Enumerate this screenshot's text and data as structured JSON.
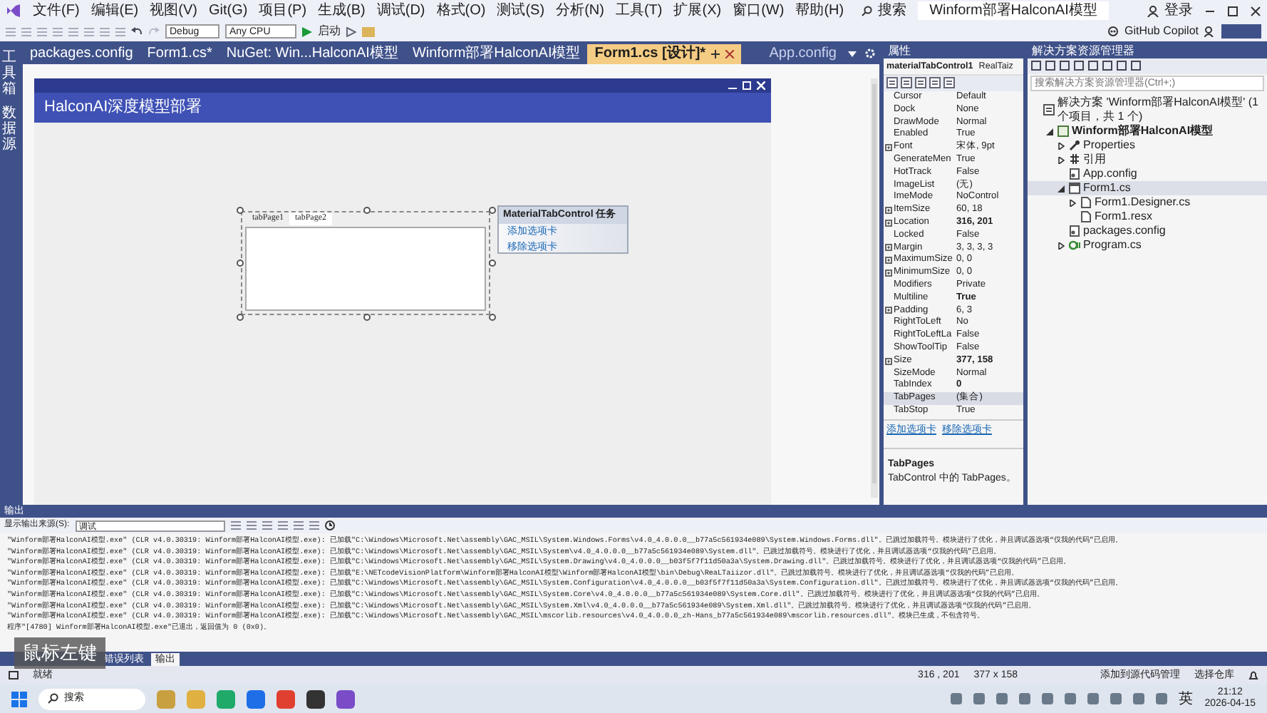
{
  "title_bar": {
    "menu": [
      "文件(F)",
      "编辑(E)",
      "视图(V)",
      "Git(G)",
      "项目(P)",
      "生成(B)",
      "调试(D)",
      "格式(O)",
      "测试(S)",
      "分析(N)",
      "工具(T)",
      "扩展(X)",
      "窗口(W)",
      "帮助(H)"
    ],
    "search": "搜索",
    "solution_name": "Winform部署HalconAI模型",
    "sign_in": "登录"
  },
  "toolbar": {
    "configuration": "Debug",
    "platform": "Any CPU",
    "start": "启动",
    "copilot": "GitHub Copilot"
  },
  "left_tool_tabs": [
    "工具箱",
    "数据源"
  ],
  "document_tabs": [
    {
      "label": "packages.config",
      "selected": false
    },
    {
      "label": "Form1.cs*",
      "selected": false
    },
    {
      "label": "NuGet: Win...HalconAI模型",
      "selected": false
    },
    {
      "label": "Winform部署HalconAI模型",
      "selected": false
    },
    {
      "label": "Form1.cs [设计]*",
      "selected": true
    }
  ],
  "side_tab": {
    "label": "App.config"
  },
  "form": {
    "title": "HalconAI深度模型部署",
    "tab_control": {
      "tabs": [
        {
          "label": "tabPage1",
          "selected": false
        },
        {
          "label": "tabPage2",
          "selected": true
        }
      ]
    },
    "smart_tag": {
      "title": "MaterialTabControl 任务",
      "links": [
        "添加选项卡",
        "移除选项卡"
      ]
    }
  },
  "properties": {
    "title": "属性",
    "object": "materialTabControl1",
    "type": "RealTaiz",
    "rows": [
      {
        "name": "Cursor",
        "value": "Default",
        "expandable": false,
        "modified": false,
        "selected": false
      },
      {
        "name": "Dock",
        "value": "None",
        "expandable": false,
        "modified": false,
        "selected": false
      },
      {
        "name": "DrawMode",
        "value": "Normal",
        "expandable": false,
        "modified": false,
        "selected": false
      },
      {
        "name": "Enabled",
        "value": "True",
        "expandable": false,
        "modified": false,
        "selected": false
      },
      {
        "name": "Font",
        "value": "宋体, 9pt",
        "expandable": true,
        "modified": false,
        "selected": false
      },
      {
        "name": "GenerateMen",
        "value": "True",
        "expandable": false,
        "modified": false,
        "selected": false
      },
      {
        "name": "HotTrack",
        "value": "False",
        "expandable": false,
        "modified": false,
        "selected": false
      },
      {
        "name": "ImageList",
        "value": "(无)",
        "expandable": false,
        "modified": false,
        "selected": false
      },
      {
        "name": "ImeMode",
        "value": "NoControl",
        "expandable": false,
        "modified": false,
        "selected": false
      },
      {
        "name": "ItemSize",
        "value": "60, 18",
        "expandable": true,
        "modified": false,
        "selected": false
      },
      {
        "name": "Location",
        "value": "316, 201",
        "expandable": true,
        "modified": true,
        "selected": false
      },
      {
        "name": "Locked",
        "value": "False",
        "expandable": false,
        "modified": false,
        "selected": false
      },
      {
        "name": "Margin",
        "value": "3, 3, 3, 3",
        "expandable": true,
        "modified": false,
        "selected": false
      },
      {
        "name": "MaximumSize",
        "value": "0, 0",
        "expandable": true,
        "modified": false,
        "selected": false
      },
      {
        "name": "MinimumSize",
        "value": "0, 0",
        "expandable": true,
        "modified": false,
        "selected": false
      },
      {
        "name": "Modifiers",
        "value": "Private",
        "expandable": false,
        "modified": false,
        "selected": false
      },
      {
        "name": "Multiline",
        "value": "True",
        "expandable": false,
        "modified": true,
        "selected": false
      },
      {
        "name": "Padding",
        "value": "6, 3",
        "expandable": true,
        "modified": false,
        "selected": false
      },
      {
        "name": "RightToLeft",
        "value": "No",
        "expandable": false,
        "modified": false,
        "selected": false
      },
      {
        "name": "RightToLeftLa",
        "value": "False",
        "expandable": false,
        "modified": false,
        "selected": false
      },
      {
        "name": "ShowToolTip",
        "value": "False",
        "expandable": false,
        "modified": false,
        "selected": false
      },
      {
        "name": "Size",
        "value": "377, 158",
        "expandable": true,
        "modified": true,
        "selected": false
      },
      {
        "name": "SizeMode",
        "value": "Normal",
        "expandable": false,
        "modified": false,
        "selected": false
      },
      {
        "name": "TabIndex",
        "value": "0",
        "expandable": false,
        "modified": true,
        "selected": false
      },
      {
        "name": "TabPages",
        "value": "(集合)",
        "expandable": false,
        "modified": false,
        "selected": true
      },
      {
        "name": "TabStop",
        "value": "True",
        "expandable": false,
        "modified": false,
        "selected": false
      }
    ],
    "commands": [
      "添加选项卡",
      "移除选项卡"
    ],
    "description_title": "TabPages",
    "description": "TabControl 中的 TabPages。"
  },
  "solution_explorer": {
    "title": "解决方案资源管理器",
    "search_placeholder": "搜索解决方案资源管理器(Ctrl+;)",
    "tree": [
      {
        "label": "解决方案 'Winform部署HalconAI模型' (1 个项目，共 1 个)",
        "kind": "solution",
        "selected": false,
        "children": [
          {
            "label": "Winform部署HalconAI模型",
            "kind": "project",
            "expanded": true,
            "selected": false,
            "children": [
              {
                "label": "Properties",
                "kind": "wrench",
                "expanded": false,
                "selected": false
              },
              {
                "label": "引用",
                "kind": "references",
                "expanded": false,
                "selected": false
              },
              {
                "label": "App.config",
                "kind": "config",
                "selected": false
              },
              {
                "label": "Form1.cs",
                "kind": "form",
                "expanded": true,
                "selected": true,
                "children": [
                  {
                    "label": "Form1.Designer.cs",
                    "kind": "file",
                    "expanded": false,
                    "selected": false
                  },
                  {
                    "label": "Form1.resx",
                    "kind": "file",
                    "selected": false
                  }
                ]
              },
              {
                "label": "packages.config",
                "kind": "config",
                "selected": false
              },
              {
                "label": "Program.cs",
                "kind": "csharp",
                "expanded": false,
                "selected": false
              }
            ]
          }
        ]
      }
    ]
  },
  "output": {
    "title": "输出",
    "source_label": "显示输出来源(S):",
    "source": "调试",
    "lines": [
      "\"Winform部署HalconAI模型.exe\" (CLR v4.0.30319: Winform部署HalconAI模型.exe): 已加载\"C:\\Windows\\Microsoft.Net\\assembly\\GAC_MSIL\\System.Windows.Forms\\v4.0_4.0.0.0__b77a5c561934e089\\System.Windows.Forms.dll\"。已跳过加载符号。模块进行了优化，并且调试器选项“仅我的代码”已启用。",
      "\"Winform部署HalconAI模型.exe\" (CLR v4.0.30319: Winform部署HalconAI模型.exe): 已加载\"C:\\Windows\\Microsoft.Net\\assembly\\GAC_MSIL\\System\\v4.0_4.0.0.0__b77a5c561934e089\\System.dll\"。已跳过加载符号。模块进行了优化，并且调试器选项“仅我的代码”已启用。",
      "\"Winform部署HalconAI模型.exe\" (CLR v4.0.30319: Winform部署HalconAI模型.exe): 已加载\"C:\\Windows\\Microsoft.Net\\assembly\\GAC_MSIL\\System.Drawing\\v4.0_4.0.0.0__b03f5f7f11d50a3a\\System.Drawing.dll\"。已跳过加载符号。模块进行了优化，并且调试器选项“仅我的代码”已启用。",
      "\"Winform部署HalconAI模型.exe\" (CLR v4.0.30319: Winform部署HalconAI模型.exe): 已加载\"E:\\NETcodeVisionPlatform\\Winform部署HalconAI模型\\Winform部署HalconAI模型\\bin\\Debug\\ReaLTaiizor.dll\"。已跳过加载符号。模块进行了优化，并且调试器选项“仅我的代码”已启用。",
      "\"Winform部署HalconAI模型.exe\" (CLR v4.0.30319: Winform部署HalconAI模型.exe): 已加载\"C:\\Windows\\Microsoft.Net\\assembly\\GAC_MSIL\\System.Configuration\\v4.0_4.0.0.0__b03f5f7f11d50a3a\\System.Configuration.dll\"。已跳过加载符号。模块进行了优化，并且调试器选项“仅我的代码”已启用。",
      "\"Winform部署HalconAI模型.exe\" (CLR v4.0.30319: Winform部署HalconAI模型.exe): 已加载\"C:\\Windows\\Microsoft.Net\\assembly\\GAC_MSIL\\System.Core\\v4.0_4.0.0.0__b77a5c561934e089\\System.Core.dll\"。已跳过加载符号。模块进行了优化，并且调试器选项“仅我的代码”已启用。",
      "\"Winform部署HalconAI模型.exe\" (CLR v4.0.30319: Winform部署HalconAI模型.exe): 已加载\"C:\\Windows\\Microsoft.Net\\assembly\\GAC_MSIL\\System.Xml\\v4.0_4.0.0.0__b77a5c561934e089\\System.Xml.dll\"。已跳过加载符号。模块进行了优化，并且调试器选项“仅我的代码”已启用。",
      "\"Winform部署HalconAI模型.exe\" (CLR v4.0.30319: Winform部署HalconAI模型.exe): 已加载\"C:\\Windows\\Microsoft.Net\\assembly\\GAC_MSIL\\mscorlib.resources\\v4.0_4.0.0.0_zh-Hans_b77a5c561934e089\\mscorlib.resources.dll\"。模块已生成，不包含符号。",
      "程序\"[4780] Winform部署HalconAI模型.exe\"已退出，返回值为 0 (0x0)。"
    ]
  },
  "bottom_tabs": [
    {
      "label": "错误列表",
      "selected": false
    },
    {
      "label": "输出",
      "selected": true
    }
  ],
  "key_overlay": "鼠标左键",
  "status_bar": {
    "message": "就绪",
    "position": "316 , 201",
    "size": "377 x 158",
    "source_control": "添加到源代码管理",
    "repository": "选择仓库"
  },
  "taskbar": {
    "search": "搜索",
    "language": "英",
    "time": "21:12",
    "date": "2026-04-15"
  }
}
